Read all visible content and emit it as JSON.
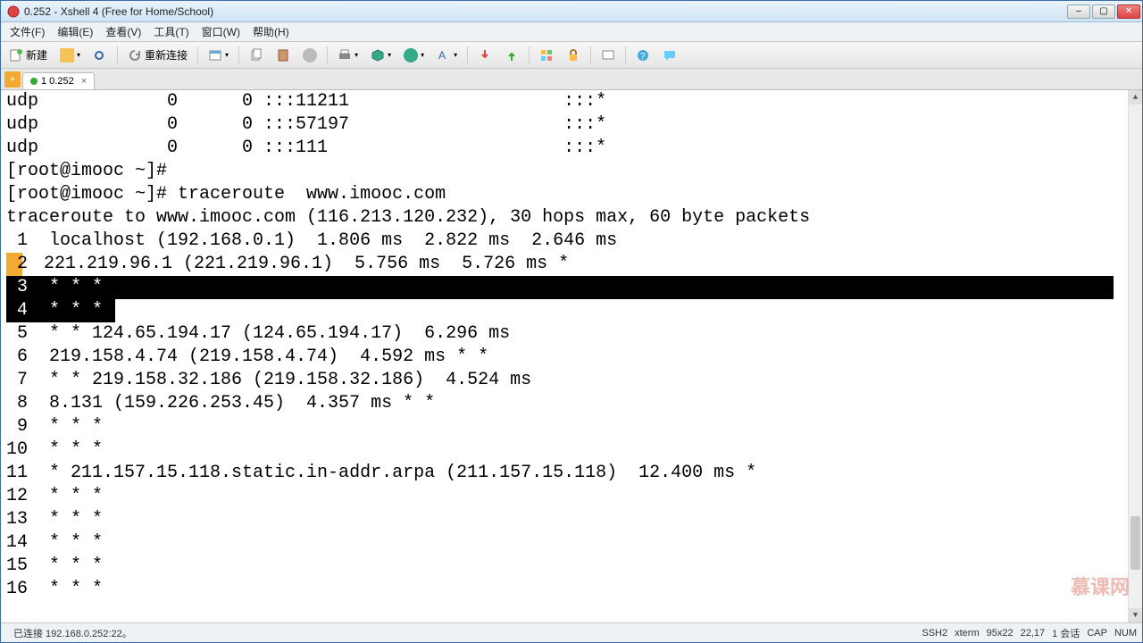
{
  "title": "0.252 - Xshell 4 (Free for Home/School)",
  "menu": [
    "文件(F)",
    "编辑(E)",
    "查看(V)",
    "工具(T)",
    "窗口(W)",
    "帮助(H)"
  ],
  "toolbar": {
    "new_label": "新建",
    "reconnect_label": "重新连接"
  },
  "tab": {
    "label": "1 0.252"
  },
  "terminal": {
    "lines": [
      "udp            0      0 :::11211                    :::*",
      "udp            0      0 :::57197                    :::*",
      "udp            0      0 :::111                      :::*",
      "[root@imooc ~]#",
      "[root@imooc ~]# traceroute  www.imooc.com",
      "traceroute to www.imooc.com (116.213.120.232), 30 hops max, 60 byte packets",
      " 1  localhost (192.168.0.1)  1.806 ms  2.822 ms  2.646 ms",
      "",
      "",
      "",
      " 5  * * 124.65.194.17 (124.65.194.17)  6.296 ms",
      " 6  219.158.4.74 (219.158.4.74)  4.592 ms * *",
      " 7  * * 219.158.32.186 (219.158.32.186)  4.524 ms",
      " 8  8.131 (159.226.253.45)  4.357 ms * *",
      " 9  * * *",
      "10  * * *",
      "11  * 211.157.15.118.static.in-addr.arpa (211.157.15.118)  12.400 ms *",
      "12  * * *",
      "13  * * *",
      "14  * * *",
      "15  * * *",
      "16  * * *"
    ],
    "line2_full": " 2  221.219.96.1 (221.219.96.1)  5.756 ms  5.726 ms *",
    "sel_line3": " 3  * * *",
    "sel_line4_a": " 4  * * *"
  },
  "status": {
    "left": "已连接 192.168.0.252:22。",
    "ssh": "SSH2",
    "term": "xterm",
    "size": "95x22",
    "pos": "22,17",
    "sess": "1 会话",
    "cap": "CAP",
    "num": "NUM"
  },
  "watermark": "慕课网"
}
